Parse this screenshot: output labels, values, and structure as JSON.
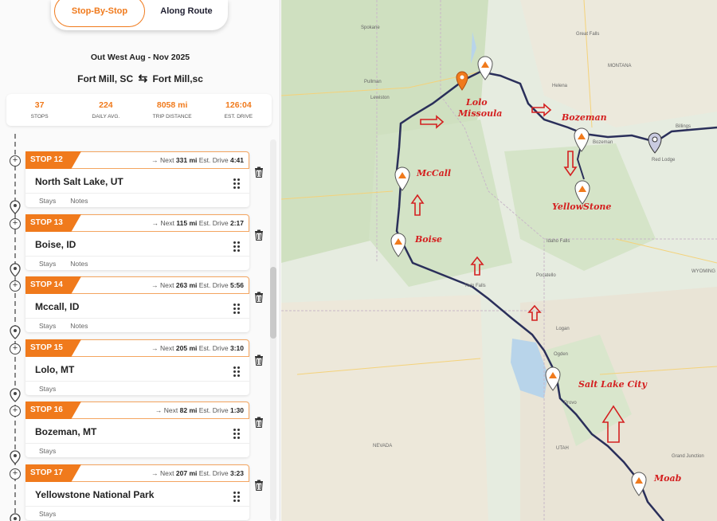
{
  "tabs": {
    "stop_by_stop": "Stop-By-Stop",
    "along_route": "Along Route"
  },
  "trip": {
    "title": "Out West Aug - Nov 2025",
    "from": "Fort Mill, SC",
    "to": "Fort Mill,sc"
  },
  "stats": [
    {
      "value": "37",
      "label": "STOPS"
    },
    {
      "value": "224",
      "label": "DAILY AVG."
    },
    {
      "value": "8058 mi",
      "label": "TRIP DISTANCE"
    },
    {
      "value": "126:04",
      "label": "EST. DRIVE"
    }
  ],
  "stops": [
    {
      "tag": "STOP 12",
      "next_dist": "331",
      "drive": "4:41",
      "name": "North Salt Lake, UT",
      "links": [
        "Stays",
        "Notes"
      ]
    },
    {
      "tag": "STOP 13",
      "next_dist": "115",
      "drive": "2:17",
      "name": "Boise, ID",
      "links": [
        "Stays",
        "Notes"
      ]
    },
    {
      "tag": "STOP 14",
      "next_dist": "263",
      "drive": "5:56",
      "name": "Mccall, ID",
      "links": [
        "Stays",
        "Notes"
      ]
    },
    {
      "tag": "STOP 15",
      "next_dist": "205",
      "drive": "3:10",
      "name": "Lolo, MT",
      "links": [
        "Stays"
      ]
    },
    {
      "tag": "STOP 16",
      "next_dist": "82",
      "drive": "1:30",
      "name": "Bozeman, MT",
      "links": [
        "Stays"
      ]
    },
    {
      "tag": "STOP 17",
      "next_dist": "207",
      "drive": "3:23",
      "name": "Yellowstone National Park",
      "links": [
        "Stays"
      ]
    }
  ],
  "labels": {
    "next": "Next",
    "mi": "mi",
    "est_drive": "Est. Drive"
  },
  "map_annotations": [
    "Lolo",
    "Missoula",
    "Bozeman",
    "McCall",
    "YellowStone",
    "Boise",
    "Salt Lake City",
    "Moab"
  ],
  "map_places": [
    "Spokane",
    "Great Falls",
    "Helena",
    "MONTANA",
    "Billings",
    "Twin Falls",
    "Pocatello",
    "Idaho Falls",
    "Logan",
    "Ogden",
    "Provo",
    "Grand Junction",
    "WYOMING",
    "NEVADA",
    "UTAH",
    "Lewiston",
    "Pullman",
    "Bozeman",
    "Red Lodge"
  ],
  "colors": {
    "accent": "#f07a1c",
    "route": "#2a2f5a",
    "annotation": "#d42020"
  }
}
